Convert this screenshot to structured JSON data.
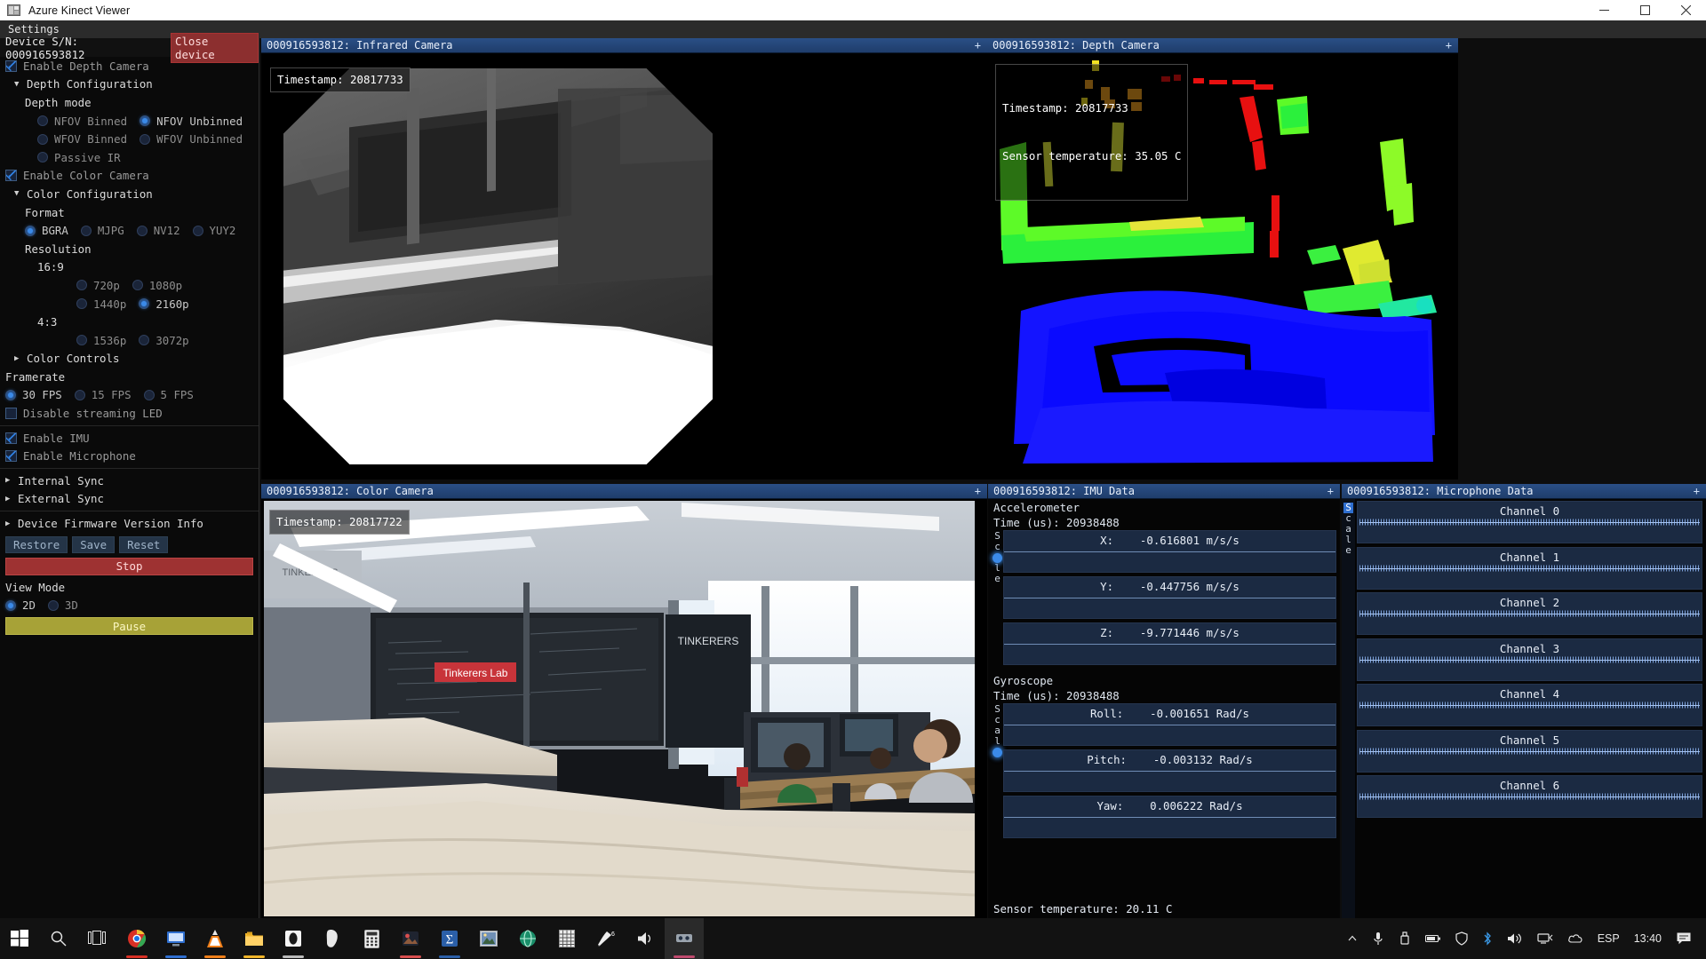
{
  "window": {
    "title": "Azure Kinect Viewer",
    "icon": "app-window-icon",
    "minimize_label": "─",
    "maximize_label": "☐",
    "close_label": "✕"
  },
  "menubar": {
    "items": [
      {
        "label": "Settings"
      }
    ]
  },
  "settings": {
    "device_label": "Device S/N: 000916593812",
    "close_device_label": "Close device",
    "enable_depth_camera": "Enable Depth Camera",
    "depth_configuration": "Depth Configuration",
    "depth_mode_label": "Depth mode",
    "depth_modes": [
      {
        "label": "NFOV Binned",
        "selected": false
      },
      {
        "label": "NFOV Unbinned",
        "selected": true
      },
      {
        "label": "WFOV Binned",
        "selected": false
      },
      {
        "label": "WFOV Unbinned",
        "selected": false
      },
      {
        "label": "Passive IR",
        "selected": false
      }
    ],
    "enable_color_camera": "Enable Color Camera",
    "color_configuration": "Color Configuration",
    "format_label": "Format",
    "formats": [
      {
        "label": "BGRA",
        "selected": true
      },
      {
        "label": "MJPG",
        "selected": false
      },
      {
        "label": "NV12",
        "selected": false
      },
      {
        "label": "YUY2",
        "selected": false
      }
    ],
    "resolution_label": "Resolution",
    "ratio_16_9": "16:9",
    "res_16_9": [
      {
        "label": "720p",
        "selected": false
      },
      {
        "label": "1080p",
        "selected": false
      },
      {
        "label": "1440p",
        "selected": false
      },
      {
        "label": "2160p",
        "selected": true
      }
    ],
    "ratio_4_3": "4:3",
    "res_4_3": [
      {
        "label": "1536p",
        "selected": false
      },
      {
        "label": "3072p",
        "selected": false
      }
    ],
    "color_controls": "Color Controls",
    "framerate_label": "Framerate",
    "framerates": [
      {
        "label": "30 FPS",
        "selected": true
      },
      {
        "label": "15 FPS",
        "selected": false
      },
      {
        "label": "5 FPS",
        "selected": false
      }
    ],
    "disable_streaming_led": "Disable streaming LED",
    "enable_imu": "Enable IMU",
    "enable_microphone": "Enable Microphone",
    "internal_sync": "Internal Sync",
    "external_sync": "External Sync",
    "device_firmware_version_info": "Device Firmware Version Info",
    "restore_label": "Restore",
    "save_label": "Save",
    "reset_label": "Reset",
    "stop_label": "Stop",
    "view_mode_label": "View Mode",
    "view_modes": [
      {
        "label": "2D",
        "selected": true
      },
      {
        "label": "3D",
        "selected": false
      }
    ],
    "pause_label": "Pause"
  },
  "panels": {
    "infrared": {
      "title": "000916593812: Infrared Camera",
      "plus": "+",
      "timestamp": "Timestamp: 20817733"
    },
    "depth": {
      "title": "000916593812: Depth Camera",
      "plus": "+",
      "timestamp": "Timestamp: 20817733",
      "sensor_temperature": "Sensor temperature: 35.05 C"
    },
    "color": {
      "title": "000916593812: Color Camera",
      "plus": "+",
      "timestamp": "Timestamp: 20817722"
    },
    "imu": {
      "title": "000916593812: IMU Data",
      "plus": "+",
      "scale_label": "Scale",
      "accelerometer": {
        "heading": "Accelerometer",
        "time": "Time (us): 20938488",
        "rows": [
          {
            "axis": "X:",
            "value": "-0.616801 m/s/s"
          },
          {
            "axis": "Y:",
            "value": "-0.447756 m/s/s"
          },
          {
            "axis": "Z:",
            "value": "-9.771446 m/s/s"
          }
        ]
      },
      "gyroscope": {
        "heading": "Gyroscope",
        "time": "Time (us): 20938488",
        "rows": [
          {
            "axis": "Roll:",
            "value": "-0.001651 Rad/s"
          },
          {
            "axis": "Pitch:",
            "value": "-0.003132 Rad/s"
          },
          {
            "axis": "Yaw:",
            "value": "0.006222 Rad/s"
          }
        ]
      },
      "sensor_temperature": "Sensor temperature: 20.11 C"
    },
    "microphone": {
      "title": "000916593812: Microphone Data",
      "plus": "+",
      "scale_label": "Scale",
      "channels": [
        {
          "label": "Channel 0"
        },
        {
          "label": "Channel 1"
        },
        {
          "label": "Channel 2"
        },
        {
          "label": "Channel 3"
        },
        {
          "label": "Channel 4"
        },
        {
          "label": "Channel 5"
        },
        {
          "label": "Channel 6"
        }
      ]
    }
  },
  "taskbar": {
    "start": "start-icon",
    "search": "search-icon",
    "taskview": "task-view-icon",
    "apps": [
      "chrome-icon",
      "remote-desktop-icon",
      "vlc-icon",
      "file-explorer-icon",
      "opera-icon",
      "device-icon",
      "calculator-icon",
      "photos-icon",
      "math-icon",
      "image-viewer-icon",
      "browser-icon",
      "spreadsheet-icon",
      "editor-icon",
      "audio-icon",
      "kinect-viewer-icon"
    ],
    "tray": {
      "chevron": "show-hidden-icons-chevron",
      "mic": "microphone-icon",
      "usb": "usb-device-icon",
      "battery": "battery-icon",
      "shield": "security-icon",
      "bluetooth": "bluetooth-icon",
      "volume": "volume-icon",
      "network": "network-icon",
      "onedrive": "onedrive-icon",
      "language": "ESP",
      "clock": "13:40",
      "notifications": "notifications-icon"
    }
  },
  "colors": {
    "accent_blue": "#2f7fe0",
    "title_gradient_top": "#2a4f86",
    "stop_red": "#9e3232",
    "pause_yellow": "#a7a237",
    "close_device_red": "#8c2f2f",
    "plot_bg": "#1b2a42"
  }
}
